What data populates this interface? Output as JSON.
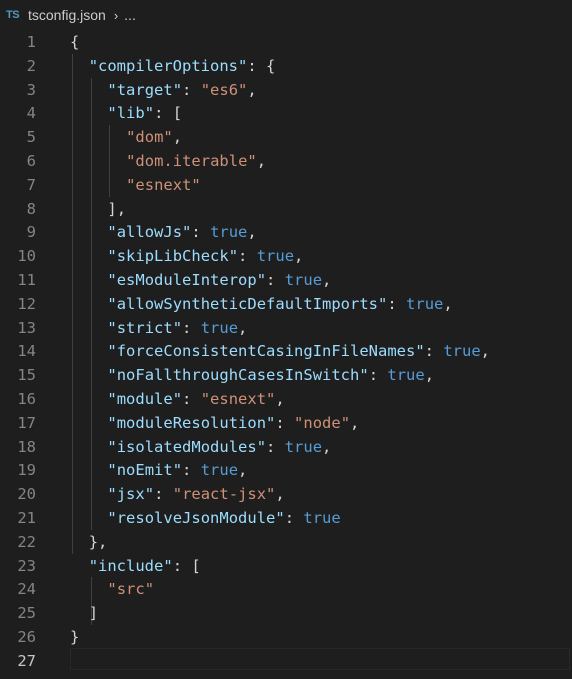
{
  "breadcrumb": {
    "icon": "TS",
    "file": "tsconfig.json",
    "separator": "›",
    "more": "..."
  },
  "line_numbers": [
    "1",
    "2",
    "3",
    "4",
    "5",
    "6",
    "7",
    "8",
    "9",
    "10",
    "11",
    "12",
    "13",
    "14",
    "15",
    "16",
    "17",
    "18",
    "19",
    "20",
    "21",
    "22",
    "23",
    "24",
    "25",
    "26",
    "27"
  ],
  "active_line": "27",
  "code_lines": [
    [
      {
        "t": "punc",
        "v": "{"
      }
    ],
    [
      {
        "t": "key",
        "v": "\"compilerOptions\""
      },
      {
        "t": "punc",
        "v": ": {"
      }
    ],
    [
      {
        "t": "key",
        "v": "\"target\""
      },
      {
        "t": "punc",
        "v": ": "
      },
      {
        "t": "str",
        "v": "\"es6\""
      },
      {
        "t": "punc",
        "v": ","
      }
    ],
    [
      {
        "t": "key",
        "v": "\"lib\""
      },
      {
        "t": "punc",
        "v": ": ["
      }
    ],
    [
      {
        "t": "str",
        "v": "\"dom\""
      },
      {
        "t": "punc",
        "v": ","
      }
    ],
    [
      {
        "t": "str",
        "v": "\"dom.iterable\""
      },
      {
        "t": "punc",
        "v": ","
      }
    ],
    [
      {
        "t": "str",
        "v": "\"esnext\""
      }
    ],
    [
      {
        "t": "punc",
        "v": "],"
      }
    ],
    [
      {
        "t": "key",
        "v": "\"allowJs\""
      },
      {
        "t": "punc",
        "v": ": "
      },
      {
        "t": "bool",
        "v": "true"
      },
      {
        "t": "punc",
        "v": ","
      }
    ],
    [
      {
        "t": "key",
        "v": "\"skipLibCheck\""
      },
      {
        "t": "punc",
        "v": ": "
      },
      {
        "t": "bool",
        "v": "true"
      },
      {
        "t": "punc",
        "v": ","
      }
    ],
    [
      {
        "t": "key",
        "v": "\"esModuleInterop\""
      },
      {
        "t": "punc",
        "v": ": "
      },
      {
        "t": "bool",
        "v": "true"
      },
      {
        "t": "punc",
        "v": ","
      }
    ],
    [
      {
        "t": "key",
        "v": "\"allowSyntheticDefaultImports\""
      },
      {
        "t": "punc",
        "v": ": "
      },
      {
        "t": "bool",
        "v": "true"
      },
      {
        "t": "punc",
        "v": ","
      }
    ],
    [
      {
        "t": "key",
        "v": "\"strict\""
      },
      {
        "t": "punc",
        "v": ": "
      },
      {
        "t": "bool",
        "v": "true"
      },
      {
        "t": "punc",
        "v": ","
      }
    ],
    [
      {
        "t": "key",
        "v": "\"forceConsistentCasingInFileNames\""
      },
      {
        "t": "punc",
        "v": ": "
      },
      {
        "t": "bool",
        "v": "true"
      },
      {
        "t": "punc",
        "v": ","
      }
    ],
    [
      {
        "t": "key",
        "v": "\"noFallthroughCasesInSwitch\""
      },
      {
        "t": "punc",
        "v": ": "
      },
      {
        "t": "bool",
        "v": "true"
      },
      {
        "t": "punc",
        "v": ","
      }
    ],
    [
      {
        "t": "key",
        "v": "\"module\""
      },
      {
        "t": "punc",
        "v": ": "
      },
      {
        "t": "str",
        "v": "\"esnext\""
      },
      {
        "t": "punc",
        "v": ","
      }
    ],
    [
      {
        "t": "key",
        "v": "\"moduleResolution\""
      },
      {
        "t": "punc",
        "v": ": "
      },
      {
        "t": "str",
        "v": "\"node\""
      },
      {
        "t": "punc",
        "v": ","
      }
    ],
    [
      {
        "t": "key",
        "v": "\"isolatedModules\""
      },
      {
        "t": "punc",
        "v": ": "
      },
      {
        "t": "bool",
        "v": "true"
      },
      {
        "t": "punc",
        "v": ","
      }
    ],
    [
      {
        "t": "key",
        "v": "\"noEmit\""
      },
      {
        "t": "punc",
        "v": ": "
      },
      {
        "t": "bool",
        "v": "true"
      },
      {
        "t": "punc",
        "v": ","
      }
    ],
    [
      {
        "t": "key",
        "v": "\"jsx\""
      },
      {
        "t": "punc",
        "v": ": "
      },
      {
        "t": "str",
        "v": "\"react-jsx\""
      },
      {
        "t": "punc",
        "v": ","
      }
    ],
    [
      {
        "t": "key",
        "v": "\"resolveJsonModule\""
      },
      {
        "t": "punc",
        "v": ": "
      },
      {
        "t": "bool",
        "v": "true"
      }
    ],
    [
      {
        "t": "punc",
        "v": "},"
      }
    ],
    [
      {
        "t": "key",
        "v": "\"include\""
      },
      {
        "t": "punc",
        "v": ": ["
      }
    ],
    [
      {
        "t": "str",
        "v": "\"src\""
      }
    ],
    [
      {
        "t": "punc",
        "v": "]"
      }
    ],
    [
      {
        "t": "punc",
        "v": "}"
      }
    ],
    []
  ],
  "colors": {
    "background": "#1e1e1e",
    "key": "#9cdcfe",
    "string": "#ce9178",
    "boolean": "#569cd6",
    "punctuation": "#d4d4d4",
    "line_number": "#858585"
  }
}
